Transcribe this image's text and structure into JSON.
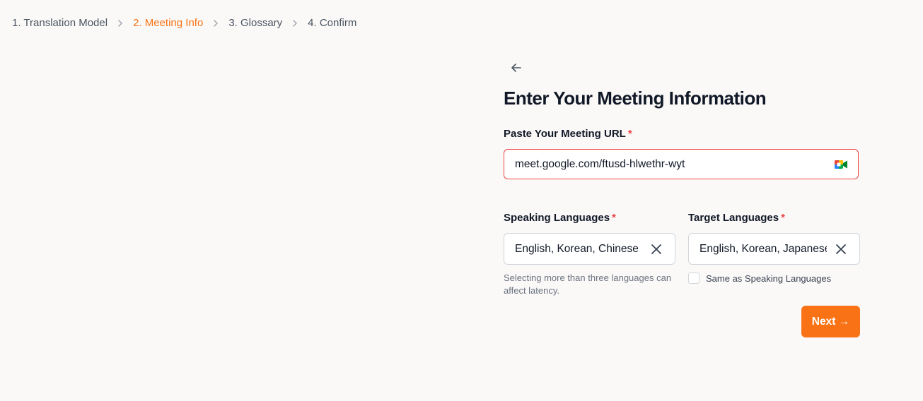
{
  "breadcrumb": [
    {
      "label": "1. Translation Model",
      "active": false
    },
    {
      "label": "2. Meeting Info",
      "active": true
    },
    {
      "label": "3. Glossary",
      "active": false
    },
    {
      "label": "4. Confirm",
      "active": false
    }
  ],
  "form": {
    "title": "Enter Your Meeting Information",
    "url_label": "Paste Your Meeting URL",
    "required_mark": "*",
    "url_value": "meet.google.com/ftusd-hlwethr-wyt",
    "url_icon": "google-meet-icon",
    "speaking": {
      "label": "Speaking Languages",
      "value": "English, Korean, Chinese",
      "helper": "Selecting more than three languages can affect latency."
    },
    "target": {
      "label": "Target Languages",
      "value": "English, Korean, Japanese",
      "same_as_label": "Same as Speaking Languages",
      "same_as_checked": false
    },
    "next_label": "Next →"
  },
  "colors": {
    "accent": "#f97316",
    "error": "#ef4444",
    "background": "#faf9f7"
  }
}
